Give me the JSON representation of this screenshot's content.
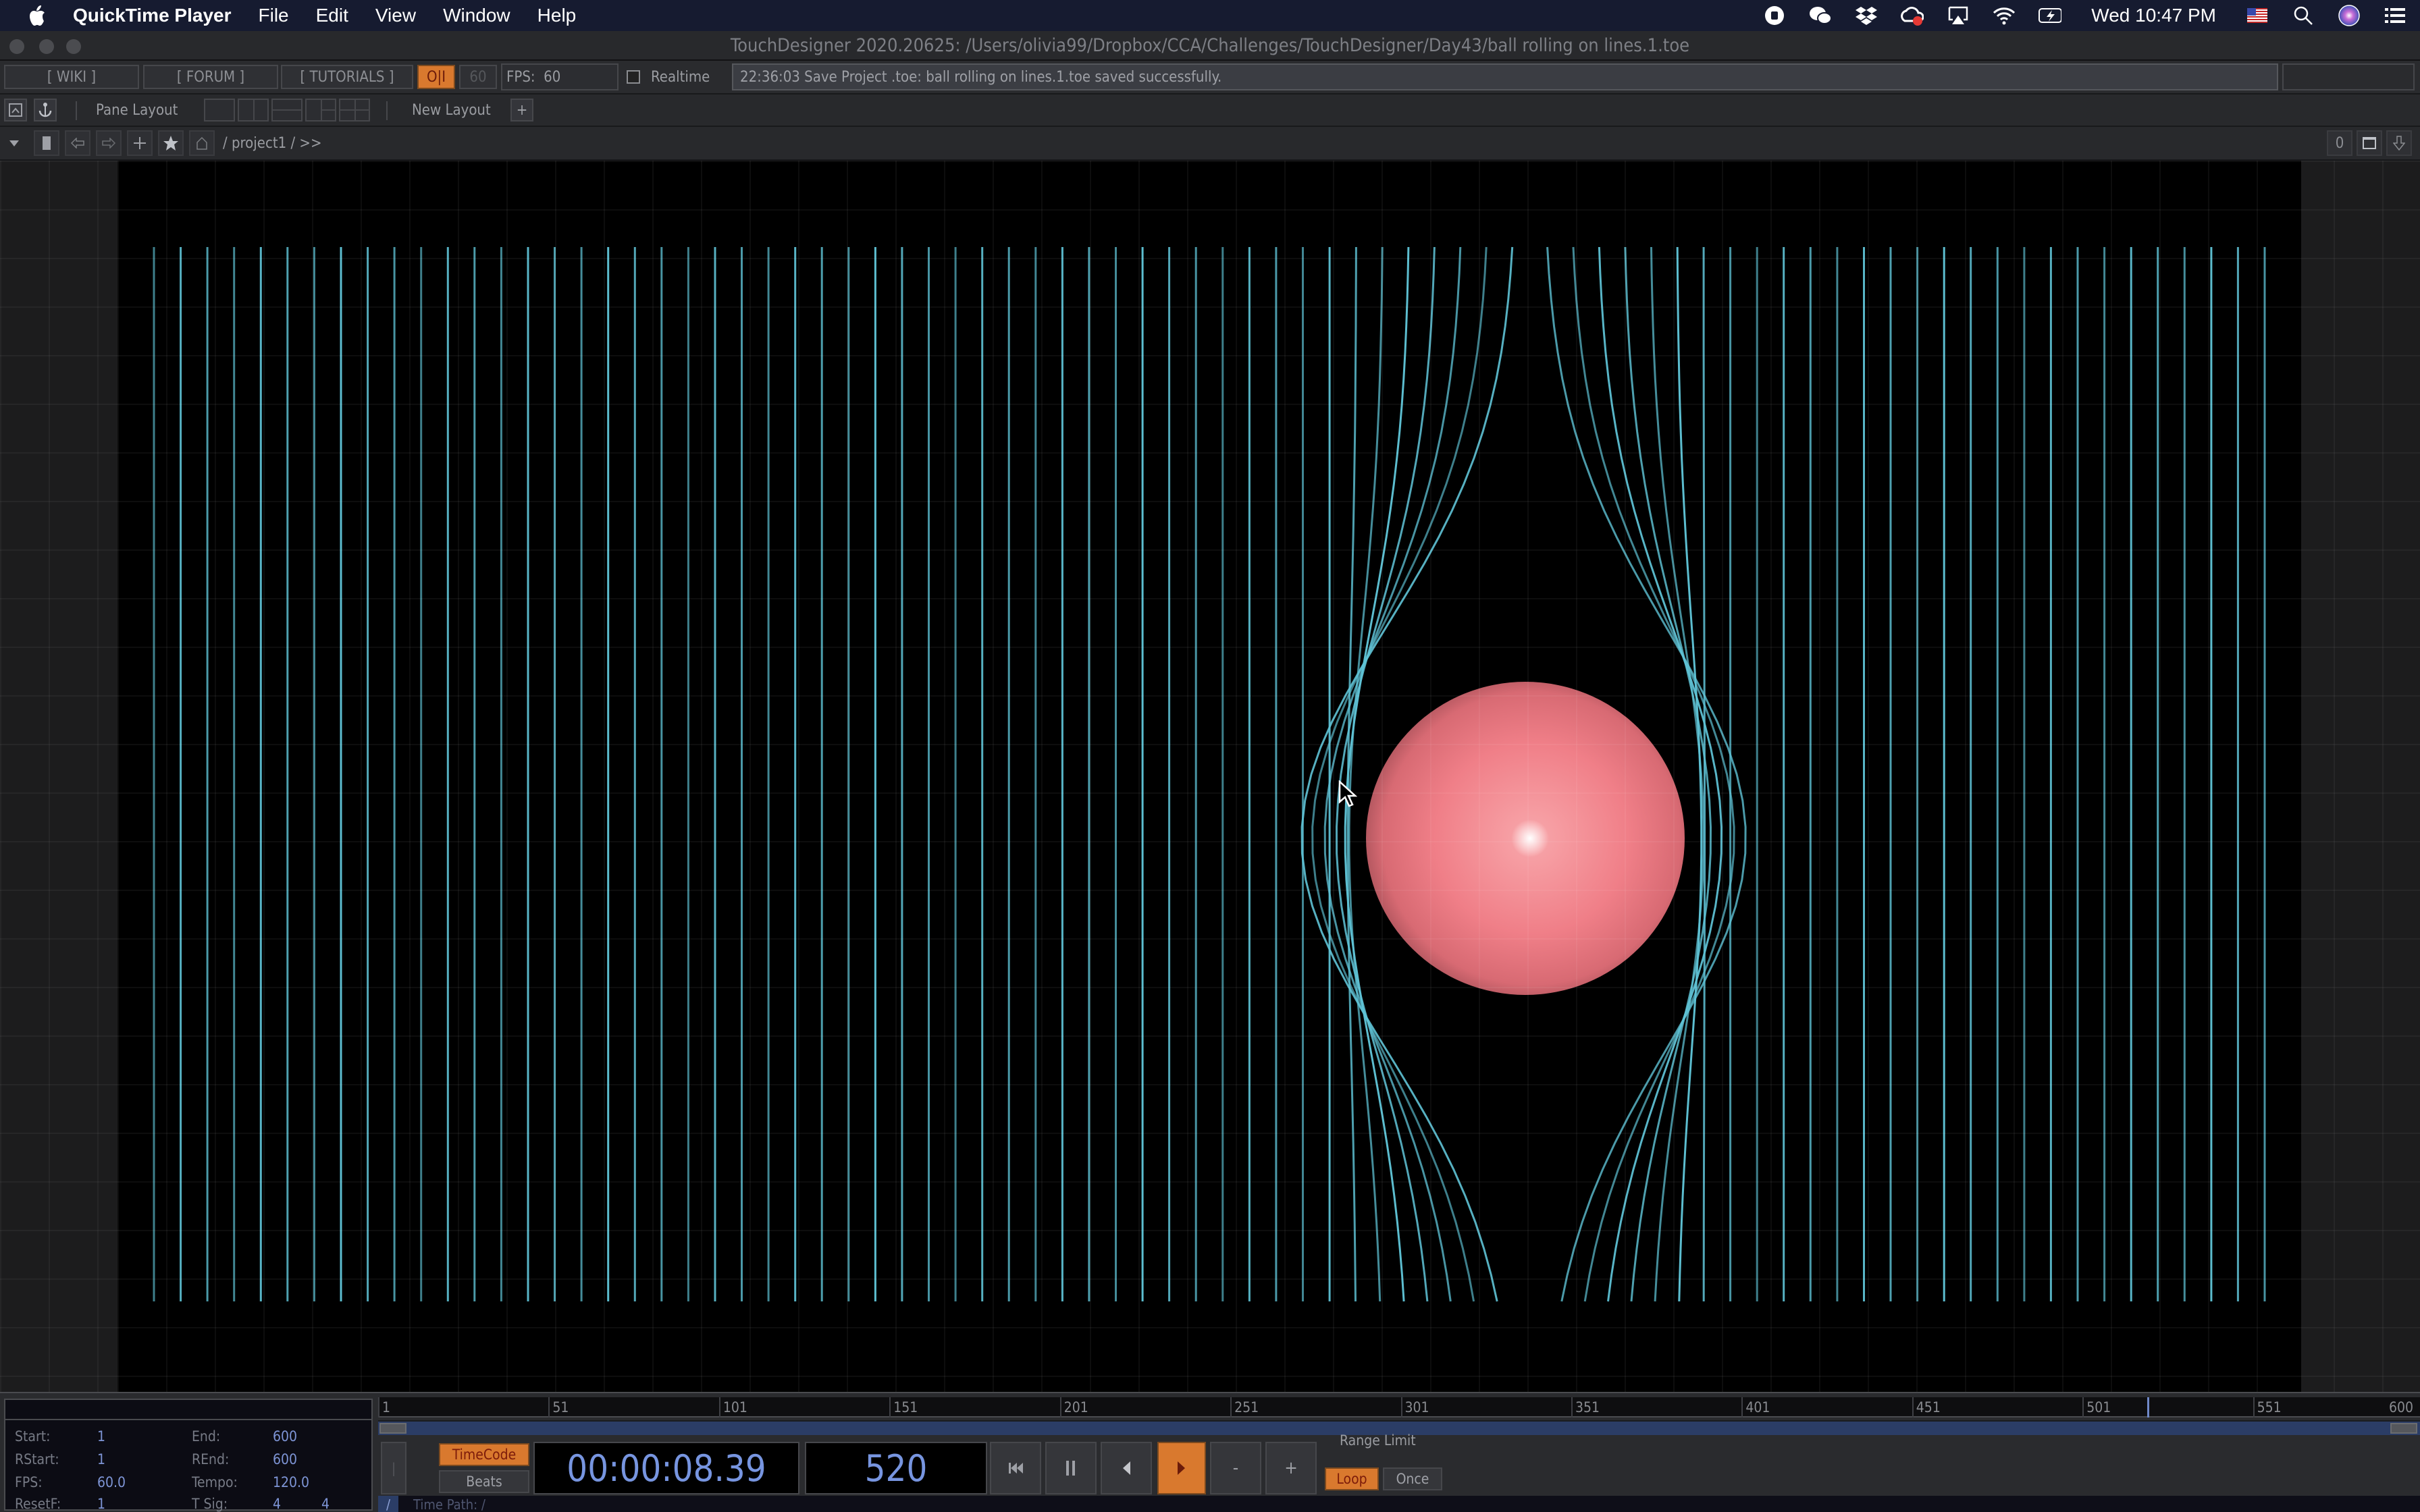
{
  "menubar": {
    "app_name": "QuickTime Player",
    "menus": [
      "File",
      "Edit",
      "View",
      "Window",
      "Help"
    ],
    "clock": "Wed 10:47 PM",
    "status_icons": [
      "screen-record-icon",
      "wechat-icon",
      "dropbox-icon",
      "creative-cloud-icon",
      "airplay-icon",
      "wifi-icon",
      "battery-charging-icon",
      "us-flag-icon",
      "spotlight-search-icon",
      "siri-icon",
      "control-center-icon"
    ]
  },
  "window": {
    "title": "TouchDesigner 2020.20625: /Users/olivia99/Dropbox/CCA/Challenges/TouchDesigner/Day43/ball rolling on lines.1.toe"
  },
  "toolbar": {
    "wiki": "[ WIKI ]",
    "forum": "[ FORUM ]",
    "tutorials": "[ TUTORIALS ]",
    "oi": "O|I",
    "fps_dim": "60",
    "fps_label": "FPS:",
    "fps_value": "60",
    "realtime_label": "Realtime",
    "realtime_checked": false,
    "status_message": "22:36:03 Save Project .toe: ball rolling on lines.1.toe saved successfully."
  },
  "layout_bar": {
    "pane_layout_label": "Pane Layout",
    "new_layout_label": "New Layout",
    "add_label": "+"
  },
  "path_bar": {
    "path": "/ project1 / >>",
    "pane_index": "0"
  },
  "scene": {
    "line_count": 80,
    "line_color": "#5fc3d6",
    "ball_color": "#f07f88",
    "background": "#000000"
  },
  "timeline": {
    "info": {
      "start_label": "Start:",
      "start": "1",
      "end_label": "End:",
      "end": "600",
      "rstart_label": "RStart:",
      "rstart": "1",
      "rend_label": "REnd:",
      "rend": "600",
      "fps_label": "FPS:",
      "fps": "60.0",
      "tempo_label": "Tempo:",
      "tempo": "120.0",
      "resetf_label": "ResetF:",
      "resetf": "1",
      "tsig_label": "T Sig:",
      "tsig_num": "4",
      "tsig_den": "4"
    },
    "ruler_ticks": [
      "1",
      "51",
      "101",
      "151",
      "201",
      "251",
      "301",
      "351",
      "401",
      "451",
      "501",
      "551",
      "600"
    ],
    "range": [
      1,
      600
    ],
    "current_frame": 520,
    "timecode_label": "TimeCode",
    "beats_label": "Beats",
    "timecode": "00:00:08.39",
    "frame_display": "520",
    "range_limit_label": "Range Limit",
    "loop_label": "Loop",
    "once_label": "Once",
    "minus_label": "-",
    "plus_label": "+",
    "time_path": "Time Path: /",
    "slash": "/"
  }
}
